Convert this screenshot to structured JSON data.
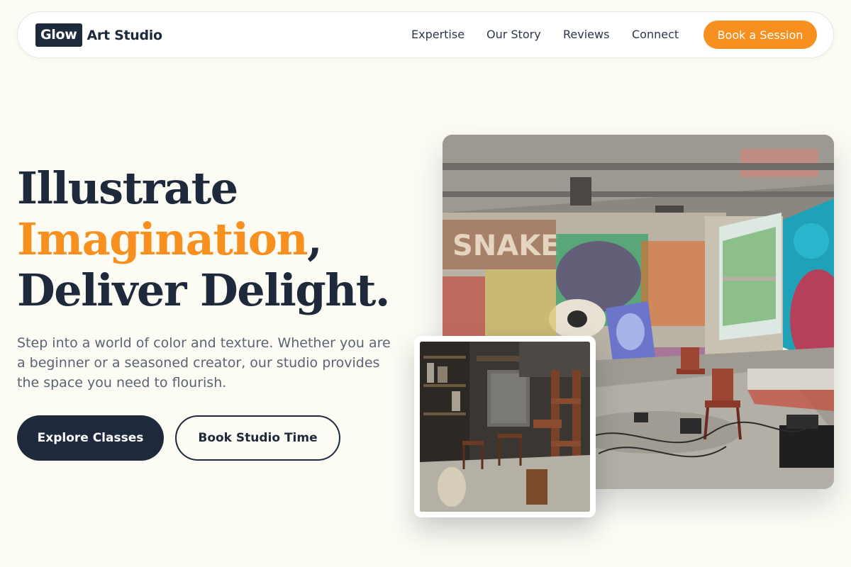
{
  "brand": {
    "logo_box_text": "Glow",
    "logo_text": "Art Studio"
  },
  "nav": {
    "links": [
      {
        "label": "Expertise"
      },
      {
        "label": "Our Story"
      },
      {
        "label": "Reviews"
      },
      {
        "label": "Connect"
      }
    ],
    "cta_label": "Book a Session"
  },
  "hero": {
    "headline_line1": "Illustrate",
    "headline_accent": "Imagination",
    "headline_comma": ",",
    "headline_line3": "Deliver Delight.",
    "subtext": "Step into a world of color and texture. Whether you are a beginner or a seasoned creator, our studio provides the space you need to flourish.",
    "primary_button": "Explore Classes",
    "secondary_button": "Book Studio Time"
  },
  "images": {
    "main": "graffiti-studio-photo",
    "secondary": "wood-workshop-photo"
  },
  "colors": {
    "accent": "#f7901e",
    "navy": "#1e293b",
    "background": "#fcfbf4"
  }
}
